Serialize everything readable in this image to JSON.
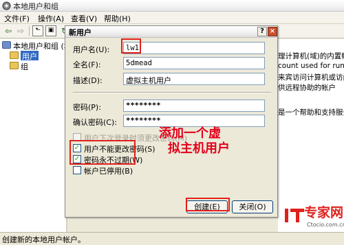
{
  "window": {
    "title": "本地用户和组",
    "title_icon": "users-gear-icon"
  },
  "menu": {
    "items": [
      "文件(F)",
      "操作(A)",
      "查看(V)",
      "帮助(H)"
    ]
  },
  "toolbar": {
    "buttons": [
      "back-arrow-icon",
      "forward-arrow-icon",
      "up-folder-icon",
      "show-hide-tree-icon",
      "refresh-icon",
      "help-icon"
    ]
  },
  "tree": {
    "root_label": "本地用户和组 (本",
    "items": [
      {
        "label": "用户",
        "icon": "folder-icon",
        "selected": true
      },
      {
        "label": "组",
        "icon": "folder-icon",
        "selected": false
      }
    ]
  },
  "right_list": {
    "rows": [
      "理计算机(域)的内置帐",
      "count used for runn",
      "来宾访问计算机或访问",
      "供远程协助的帐户",
      "",
      "",
      "",
      "",
      "是一个帮助和支持服务"
    ]
  },
  "dialog": {
    "title": "新用户",
    "help_glyph": "?",
    "close_glyph": "×",
    "fields": {
      "username_label": "用户名(U):",
      "username_value": "lw1",
      "fullname_label": "全名(F):",
      "fullname_value": "5dmead",
      "description_label": "描述(D):",
      "description_value": "虚拟主机用户",
      "password_label": "密码(P):",
      "password_value": "********",
      "confirm_label": "确认密码(C):",
      "confirm_value": "********"
    },
    "checkboxes": [
      {
        "label": "用户下次登录时须更改密码(M)",
        "checked": false,
        "enabled": false
      },
      {
        "label": "用户不能更改密码(S)",
        "checked": true,
        "enabled": true
      },
      {
        "label": "密码永不过期(W)",
        "checked": true,
        "enabled": true
      },
      {
        "label": "帐户已停用(B)",
        "checked": false,
        "enabled": true
      }
    ],
    "check_glyph": "✓",
    "buttons": {
      "create": "创建(E)",
      "close": "关闭(O)"
    }
  },
  "annotation": {
    "line1": "添加一个虚",
    "line2": "拟主机用户",
    "color": "#e3001b"
  },
  "statusbar": {
    "text": "创建新的本地用户帐户。"
  },
  "watermark": {
    "logo_text": "专家网",
    "site": "Ctocio.com.cn"
  }
}
